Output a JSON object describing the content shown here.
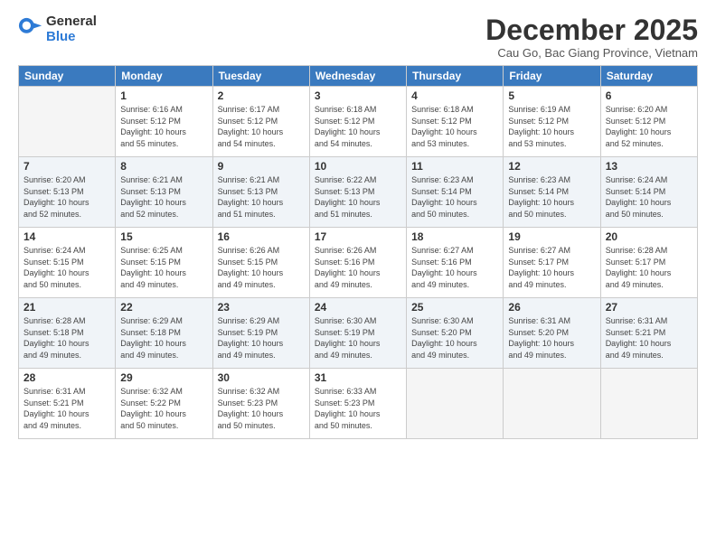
{
  "logo": {
    "general": "General",
    "blue": "Blue"
  },
  "title": "December 2025",
  "subtitle": "Cau Go, Bac Giang Province, Vietnam",
  "days_header": [
    "Sunday",
    "Monday",
    "Tuesday",
    "Wednesday",
    "Thursday",
    "Friday",
    "Saturday"
  ],
  "weeks": [
    [
      {
        "day": "",
        "info": ""
      },
      {
        "day": "1",
        "info": "Sunrise: 6:16 AM\nSunset: 5:12 PM\nDaylight: 10 hours\nand 55 minutes."
      },
      {
        "day": "2",
        "info": "Sunrise: 6:17 AM\nSunset: 5:12 PM\nDaylight: 10 hours\nand 54 minutes."
      },
      {
        "day": "3",
        "info": "Sunrise: 6:18 AM\nSunset: 5:12 PM\nDaylight: 10 hours\nand 54 minutes."
      },
      {
        "day": "4",
        "info": "Sunrise: 6:18 AM\nSunset: 5:12 PM\nDaylight: 10 hours\nand 53 minutes."
      },
      {
        "day": "5",
        "info": "Sunrise: 6:19 AM\nSunset: 5:12 PM\nDaylight: 10 hours\nand 53 minutes."
      },
      {
        "day": "6",
        "info": "Sunrise: 6:20 AM\nSunset: 5:12 PM\nDaylight: 10 hours\nand 52 minutes."
      }
    ],
    [
      {
        "day": "7",
        "info": "Sunrise: 6:20 AM\nSunset: 5:13 PM\nDaylight: 10 hours\nand 52 minutes."
      },
      {
        "day": "8",
        "info": "Sunrise: 6:21 AM\nSunset: 5:13 PM\nDaylight: 10 hours\nand 52 minutes."
      },
      {
        "day": "9",
        "info": "Sunrise: 6:21 AM\nSunset: 5:13 PM\nDaylight: 10 hours\nand 51 minutes."
      },
      {
        "day": "10",
        "info": "Sunrise: 6:22 AM\nSunset: 5:13 PM\nDaylight: 10 hours\nand 51 minutes."
      },
      {
        "day": "11",
        "info": "Sunrise: 6:23 AM\nSunset: 5:14 PM\nDaylight: 10 hours\nand 50 minutes."
      },
      {
        "day": "12",
        "info": "Sunrise: 6:23 AM\nSunset: 5:14 PM\nDaylight: 10 hours\nand 50 minutes."
      },
      {
        "day": "13",
        "info": "Sunrise: 6:24 AM\nSunset: 5:14 PM\nDaylight: 10 hours\nand 50 minutes."
      }
    ],
    [
      {
        "day": "14",
        "info": "Sunrise: 6:24 AM\nSunset: 5:15 PM\nDaylight: 10 hours\nand 50 minutes."
      },
      {
        "day": "15",
        "info": "Sunrise: 6:25 AM\nSunset: 5:15 PM\nDaylight: 10 hours\nand 49 minutes."
      },
      {
        "day": "16",
        "info": "Sunrise: 6:26 AM\nSunset: 5:15 PM\nDaylight: 10 hours\nand 49 minutes."
      },
      {
        "day": "17",
        "info": "Sunrise: 6:26 AM\nSunset: 5:16 PM\nDaylight: 10 hours\nand 49 minutes."
      },
      {
        "day": "18",
        "info": "Sunrise: 6:27 AM\nSunset: 5:16 PM\nDaylight: 10 hours\nand 49 minutes."
      },
      {
        "day": "19",
        "info": "Sunrise: 6:27 AM\nSunset: 5:17 PM\nDaylight: 10 hours\nand 49 minutes."
      },
      {
        "day": "20",
        "info": "Sunrise: 6:28 AM\nSunset: 5:17 PM\nDaylight: 10 hours\nand 49 minutes."
      }
    ],
    [
      {
        "day": "21",
        "info": "Sunrise: 6:28 AM\nSunset: 5:18 PM\nDaylight: 10 hours\nand 49 minutes."
      },
      {
        "day": "22",
        "info": "Sunrise: 6:29 AM\nSunset: 5:18 PM\nDaylight: 10 hours\nand 49 minutes."
      },
      {
        "day": "23",
        "info": "Sunrise: 6:29 AM\nSunset: 5:19 PM\nDaylight: 10 hours\nand 49 minutes."
      },
      {
        "day": "24",
        "info": "Sunrise: 6:30 AM\nSunset: 5:19 PM\nDaylight: 10 hours\nand 49 minutes."
      },
      {
        "day": "25",
        "info": "Sunrise: 6:30 AM\nSunset: 5:20 PM\nDaylight: 10 hours\nand 49 minutes."
      },
      {
        "day": "26",
        "info": "Sunrise: 6:31 AM\nSunset: 5:20 PM\nDaylight: 10 hours\nand 49 minutes."
      },
      {
        "day": "27",
        "info": "Sunrise: 6:31 AM\nSunset: 5:21 PM\nDaylight: 10 hours\nand 49 minutes."
      }
    ],
    [
      {
        "day": "28",
        "info": "Sunrise: 6:31 AM\nSunset: 5:21 PM\nDaylight: 10 hours\nand 49 minutes."
      },
      {
        "day": "29",
        "info": "Sunrise: 6:32 AM\nSunset: 5:22 PM\nDaylight: 10 hours\nand 50 minutes."
      },
      {
        "day": "30",
        "info": "Sunrise: 6:32 AM\nSunset: 5:23 PM\nDaylight: 10 hours\nand 50 minutes."
      },
      {
        "day": "31",
        "info": "Sunrise: 6:33 AM\nSunset: 5:23 PM\nDaylight: 10 hours\nand 50 minutes."
      },
      {
        "day": "",
        "info": ""
      },
      {
        "day": "",
        "info": ""
      },
      {
        "day": "",
        "info": ""
      }
    ]
  ]
}
